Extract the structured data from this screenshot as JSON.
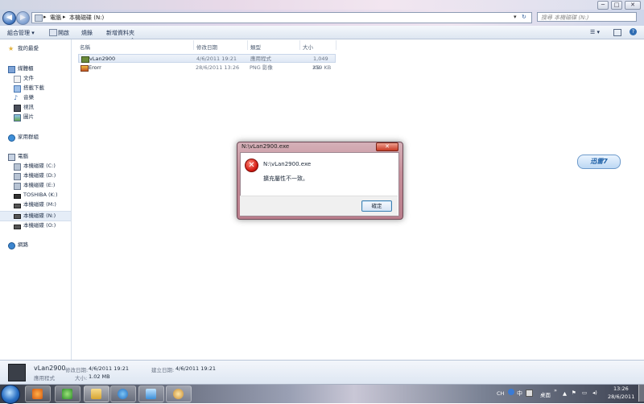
{
  "window": {
    "caption_buttons": [
      "─",
      "□",
      "✕"
    ]
  },
  "address": {
    "segments": [
      "電腦",
      "本機磁碟 (N:)"
    ],
    "separator": "▸",
    "search_placeholder": "搜尋 本機磁碟 (N:)"
  },
  "toolbar": {
    "organize": "組合管理 ▾",
    "open": "開啟",
    "burn": "燒錄",
    "new_folder": "新增資料夾"
  },
  "nav": {
    "favorites": "我的最愛",
    "libraries": "媒體櫃",
    "lib_items": [
      "文件",
      "搭載下載",
      "音樂",
      "視訊",
      "圖片"
    ],
    "homegroup": "家用群組",
    "computer": "電腦",
    "drives": [
      "本機磁碟 (C:)",
      "本機磁碟 (D:)",
      "本機磁碟 (E:)",
      "TOSHIBA (K:)",
      "本機磁碟 (M:)",
      "本機磁碟 (N:)",
      "本機磁碟 (O:)"
    ],
    "network": "網路"
  },
  "columns": {
    "name": "名稱",
    "modified": "修改日期",
    "type": "類型",
    "size": "大小"
  },
  "files": [
    {
      "name": "vLan2900",
      "modified": "4/6/2011 19:21",
      "type": "應用程式",
      "size": "1,049 KB"
    },
    {
      "name": "Erorr",
      "modified": "28/6/2011 13:26",
      "type": "PNG 影像",
      "size": "259 KB"
    }
  ],
  "details": {
    "name": "vLan2900",
    "modified_label": "修改日期:",
    "modified_value": "4/6/2011 19:21",
    "created_label": "建立日期:",
    "created_value": "4/6/2011 19:21",
    "type_value": "應用程式",
    "size_label": "大小:",
    "size_value": "1.02 MB"
  },
  "dialog": {
    "title": "N:\\vLan2900.exe",
    "path": "N:\\vLan2900.exe",
    "message": "擴充屬性不一致。",
    "ok": "確定",
    "close": "✕"
  },
  "xunlei": {
    "label": "迅雷7"
  },
  "taskbar": {
    "ime": "CH",
    "desktop": "桌面",
    "time": "13:26",
    "date": "28/6/2011"
  },
  "colors": {
    "dialog_frame": "#c58d98",
    "error_red": "#d21a12",
    "selection": "#dfe8f5"
  }
}
